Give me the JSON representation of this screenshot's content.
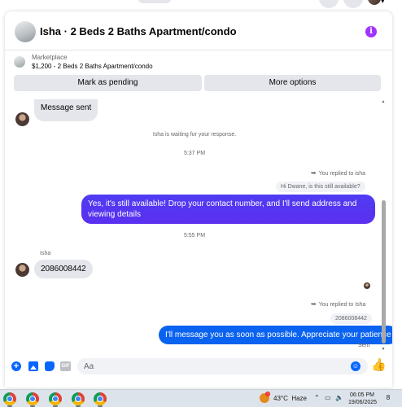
{
  "header": {
    "title": "Isha · 2 Beds 2 Baths Apartment/condo",
    "info_icon_glyph": "i"
  },
  "marketplace": {
    "label": "Marketplace",
    "listing": "$1,200 - 2 Beds 2 Baths Apartment/condo",
    "mark_pending_label": "Mark as pending",
    "more_options_label": "More options"
  },
  "messages": {
    "message_sent": "Message sent",
    "waiting_notice": "Isha is waiting for your response.",
    "time_1": "5:37 PM",
    "replied_1": "You replied to isha",
    "quoted_1": "Hi Dwane, is this still available?",
    "reply_1": "Yes, it's still available! Drop your contact number, and I'll send address and viewing details",
    "time_2": "5:55 PM",
    "sender_name": "Isha",
    "incoming_number": "2086008442",
    "replied_2": "You replied to Isha",
    "quoted_2": "2086008442",
    "reply_2": "I'll message you as soon as possible. Appreciate your patience",
    "status": "Sent"
  },
  "composer": {
    "placeholder": "Aa",
    "gif_label": "GIF",
    "icons": [
      "plus-icon",
      "photo-icon",
      "sticker-icon",
      "gif-icon",
      "emoji-icon",
      "thumbs-up-icon"
    ]
  },
  "taskbar": {
    "weather_temp": "43°C",
    "weather_condition": "Haze",
    "time": "06:05 PM",
    "date": "19/06/2025",
    "notification_count": "8",
    "app_icons": [
      "chrome-icon",
      "chrome-icon",
      "chrome-icon",
      "chrome-icon",
      "chrome-icon"
    ]
  },
  "colors": {
    "outgoing_purple": "#5b2ff0",
    "outgoing_blue": "#0a62f0",
    "incoming_grey": "#e4e6eb",
    "accent_blue": "#0866ff",
    "info_purple": "#a033ff"
  }
}
